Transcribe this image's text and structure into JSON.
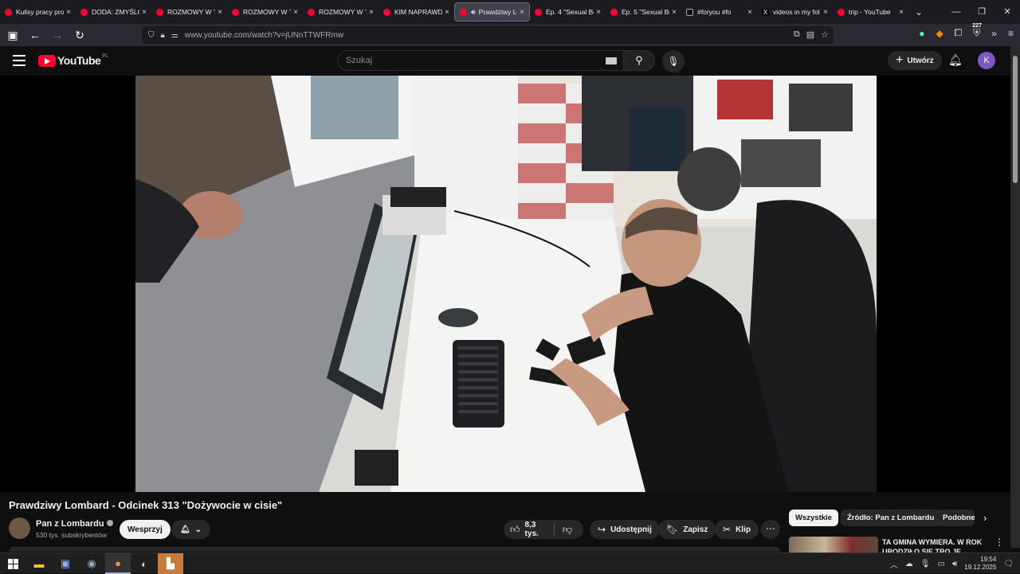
{
  "browser": {
    "tabs": [
      {
        "title": "Kulisy pracy pro",
        "icon": "youtube-icon"
      },
      {
        "title": "DODA: ZMYŚLON",
        "icon": "youtube-icon"
      },
      {
        "title": "ROZMOWY W TOK",
        "icon": "youtube-icon"
      },
      {
        "title": "ROZMOWY W TOK",
        "icon": "youtube-icon"
      },
      {
        "title": "ROZMOWY W TOK",
        "icon": "youtube-icon"
      },
      {
        "title": "KIM NAPRAWDĘ",
        "icon": "youtube-icon"
      },
      {
        "title": "Prawdziwy Lo",
        "icon": "youtube-icon",
        "active": true,
        "playing": true
      },
      {
        "title": "Ep. 4 \"Sexual Be",
        "icon": "youtube-icon"
      },
      {
        "title": "Ep. 5 \"Sexual Be",
        "icon": "youtube-icon"
      },
      {
        "title": "#foryou #fo",
        "icon": "tiktok-icon"
      },
      {
        "title": "videos in my fol",
        "icon": "x-icon"
      },
      {
        "title": "trip - YouTube",
        "icon": "youtube-icon"
      }
    ],
    "close_glyph": "×",
    "url": "www.youtube.com/watch?v=jUNnTTWFRmw",
    "extension_badge": "227"
  },
  "youtube": {
    "logo_text": "YouTube",
    "country_code": "PL",
    "search_placeholder": "Szukaj",
    "create_label": "Utwórz",
    "avatar_letter": "K"
  },
  "video": {
    "title": "Prawdziwy Lombard - Odcinek 313 \"Dożywocie w cisie\"",
    "channel": "Pan z Lombardu",
    "subscribers": "530 tys. subskrybentów",
    "support_label": "Wesprzyj",
    "likes": "8,3 tys.",
    "share_label": "Udostępnij",
    "save_label": "Zapisz",
    "clip_label": "Klip"
  },
  "chips": [
    "Wszystkie",
    "Źródło: Pan z Lombardu",
    "Podobne"
  ],
  "recommendation": {
    "title": "TA GMINA WYMIERA. W ROK URODZIŁO SIĘ TRO JE DZIECI"
  },
  "taskbar": {
    "time": "19:54",
    "date": "19.12.2025"
  }
}
